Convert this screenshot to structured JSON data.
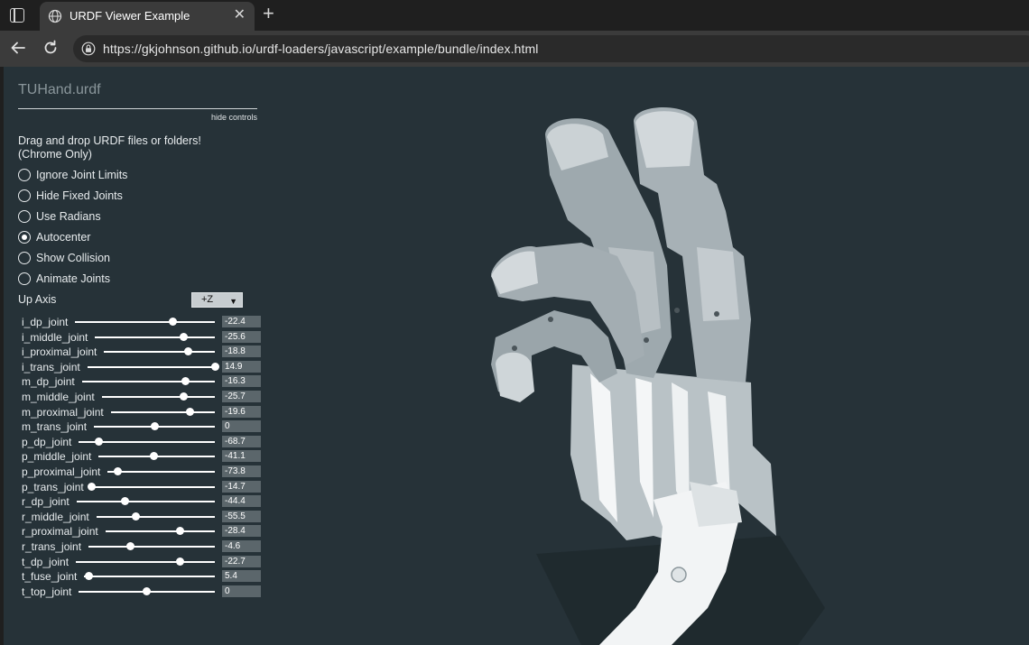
{
  "browser": {
    "tab_title": "URDF Viewer Example",
    "tab_close": "✕",
    "new_tab": "+",
    "url": "https://gkjohnson.github.io/urdf-loaders/javascript/example/bundle/index.html"
  },
  "page": {
    "title": "TUHand.urdf",
    "hide_controls": "hide controls",
    "drag_drop_line1": "Drag and drop URDF files or folders!",
    "drag_drop_line2": "(Chrome Only)",
    "toggles": [
      {
        "label": "Ignore Joint Limits",
        "checked": false
      },
      {
        "label": "Hide Fixed Joints",
        "checked": false
      },
      {
        "label": "Use Radians",
        "checked": false
      },
      {
        "label": "Autocenter",
        "checked": true
      },
      {
        "label": "Show Collision",
        "checked": false
      },
      {
        "label": "Animate Joints",
        "checked": false
      }
    ],
    "up_axis_label": "Up Axis",
    "up_axis_value": "+Z",
    "joints": [
      {
        "name": "i_dp_joint",
        "value": "-22.4",
        "level": 0.7
      },
      {
        "name": "i_middle_joint",
        "value": "-25.6",
        "level": 0.74
      },
      {
        "name": "i_proximal_joint",
        "value": "-18.8",
        "level": 0.76
      },
      {
        "name": "i_trans_joint",
        "value": "14.9",
        "level": 1.0
      },
      {
        "name": "m_dp_joint",
        "value": "-16.3",
        "level": 0.78
      },
      {
        "name": "m_middle_joint",
        "value": "-25.7",
        "level": 0.72
      },
      {
        "name": "m_proximal_joint",
        "value": "-19.6",
        "level": 0.76
      },
      {
        "name": "m_trans_joint",
        "value": "0",
        "level": 0.5
      },
      {
        "name": "p_dp_joint",
        "value": "-68.7",
        "level": 0.15
      },
      {
        "name": "p_middle_joint",
        "value": "-41.1",
        "level": 0.48
      },
      {
        "name": "p_proximal_joint",
        "value": "-73.8",
        "level": 0.1
      },
      {
        "name": "p_trans_joint",
        "value": "-14.7",
        "level": 0.0
      },
      {
        "name": "r_dp_joint",
        "value": "-44.4",
        "level": 0.35
      },
      {
        "name": "r_middle_joint",
        "value": "-55.5",
        "level": 0.33
      },
      {
        "name": "r_proximal_joint",
        "value": "-28.4",
        "level": 0.68
      },
      {
        "name": "r_trans_joint",
        "value": "-4.6",
        "level": 0.33
      },
      {
        "name": "t_dp_joint",
        "value": "-22.7",
        "level": 0.75
      },
      {
        "name": "t_fuse_joint",
        "value": "5.4",
        "level": 0.04
      },
      {
        "name": "t_top_joint",
        "value": "0",
        "level": 0.5
      }
    ]
  },
  "colors": {
    "background": "#263238",
    "model": "#cdd3d6",
    "shadow": "#1a2226"
  }
}
